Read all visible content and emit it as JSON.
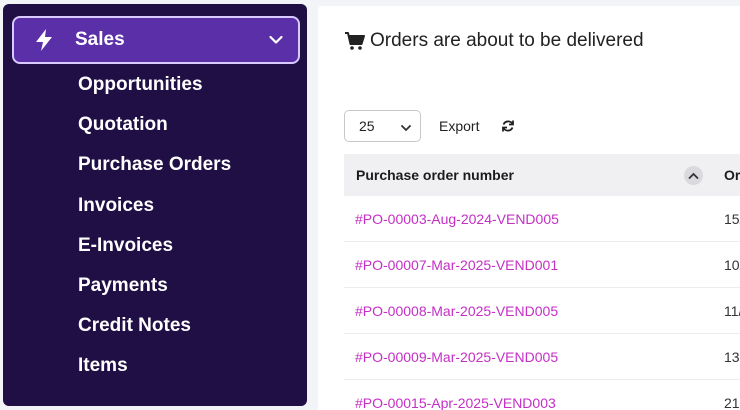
{
  "sidebar": {
    "section_label": "Sales",
    "items": [
      {
        "label": "Opportunities"
      },
      {
        "label": "Quotation"
      },
      {
        "label": "Purchase Orders"
      },
      {
        "label": "Invoices"
      },
      {
        "label": "E-Invoices"
      },
      {
        "label": "Payments"
      },
      {
        "label": "Credit Notes"
      },
      {
        "label": "Items"
      }
    ]
  },
  "main": {
    "title": "Orders are about to be delivered",
    "page_size": "25",
    "export_label": "Export",
    "columns": [
      "Purchase order number",
      "Or"
    ],
    "rows": [
      {
        "po": "#PO-00003-Aug-2024-VEND005",
        "date": "15/"
      },
      {
        "po": "#PO-00007-Mar-2025-VEND001",
        "date": "10/"
      },
      {
        "po": "#PO-00008-Mar-2025-VEND005",
        "date": "11/"
      },
      {
        "po": "#PO-00009-Mar-2025-VEND005",
        "date": "13"
      },
      {
        "po": "#PO-00015-Apr-2025-VEND003",
        "date": "21"
      }
    ]
  },
  "colors": {
    "sidebar_bg": "#1f0f45",
    "active_bg": "#5b2fa8",
    "link": "#c42fc6"
  },
  "icons": {
    "section": "lightning-bolt-icon",
    "section_toggle": "chevron-down-icon",
    "title": "shopping-cart-icon",
    "refresh": "refresh-icon",
    "sort": "chevron-up-icon"
  }
}
